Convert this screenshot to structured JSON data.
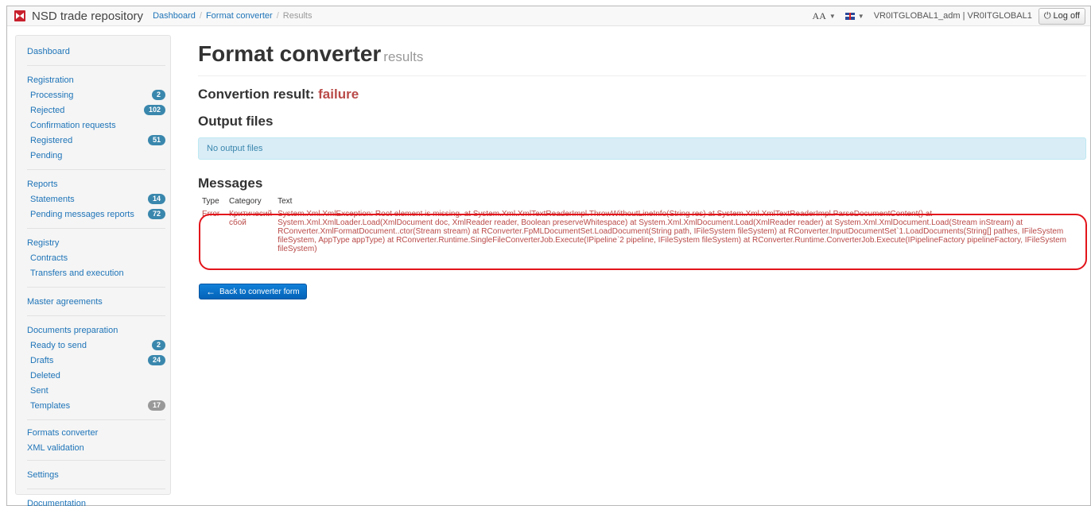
{
  "brand": "NSD trade repository",
  "breadcrumb": {
    "dashboard": "Dashboard",
    "converter": "Format converter",
    "current": "Results"
  },
  "topbar": {
    "font_size": "AA",
    "user": "VR0ITGLOBAL1_adm | VR0ITGLOBAL1",
    "logoff": "Log off"
  },
  "sidebar": {
    "dashboard": "Dashboard",
    "registration": {
      "label": "Registration",
      "items": [
        {
          "label": "Processing",
          "badge": "2"
        },
        {
          "label": "Rejected",
          "badge": "102"
        },
        {
          "label": "Confirmation requests",
          "badge": ""
        },
        {
          "label": "Registered",
          "badge": "51"
        },
        {
          "label": "Pending",
          "badge": ""
        }
      ]
    },
    "reports": {
      "label": "Reports",
      "items": [
        {
          "label": "Statements",
          "badge": "14"
        },
        {
          "label": "Pending messages reports",
          "badge": "72"
        }
      ]
    },
    "registry": {
      "label": "Registry",
      "items": [
        {
          "label": "Contracts"
        },
        {
          "label": "Transfers and execution"
        }
      ]
    },
    "master_agreements": "Master agreements",
    "docprep": {
      "label": "Documents preparation",
      "items": [
        {
          "label": "Ready to send",
          "badge": "2"
        },
        {
          "label": "Drafts",
          "badge": "24"
        },
        {
          "label": "Deleted",
          "badge": ""
        },
        {
          "label": "Sent",
          "badge": ""
        },
        {
          "label": "Templates",
          "badge": "17"
        }
      ]
    },
    "formats_converter": "Formats converter",
    "xml_validation": "XML validation",
    "settings": "Settings",
    "documentation": "Documentation"
  },
  "main": {
    "title": "Format converter",
    "subtitle": "results",
    "result_label": "Convertion result:",
    "result_value": "failure",
    "output_title": "Output files",
    "no_output": "No output files",
    "messages_title": "Messages",
    "columns": [
      "Type",
      "Category",
      "Text"
    ],
    "row": {
      "type": "Error",
      "category": "Критичесий сбой",
      "text": "System.Xml.XmlException: Root element is missing. at System.Xml.XmlTextReaderImpl.ThrowWithoutLineInfo(String res) at System.Xml.XmlTextReaderImpl.ParseDocumentContent() at System.Xml.XmlLoader.Load(XmlDocument doc, XmlReader reader, Boolean preserveWhitespace) at System.Xml.XmlDocument.Load(XmlReader reader) at System.Xml.XmlDocument.Load(Stream inStream) at RConverter.XmlFormatDocument..ctor(Stream stream) at RConverter.FpMLDocumentSet.LoadDocument(String path, IFileSystem fileSystem) at RConverter.InputDocumentSet`1.LoadDocuments(String[] pathes, IFileSystem fileSystem, AppType appType) at RConverter.Runtime.SingleFileConverterJob.Execute(IPipeline`2 pipeline, IFileSystem fileSystem) at RConverter.Runtime.ConverterJob.Execute(IPipelineFactory pipelineFactory, IFileSystem fileSystem)"
    },
    "back_button": "Back to converter form"
  }
}
